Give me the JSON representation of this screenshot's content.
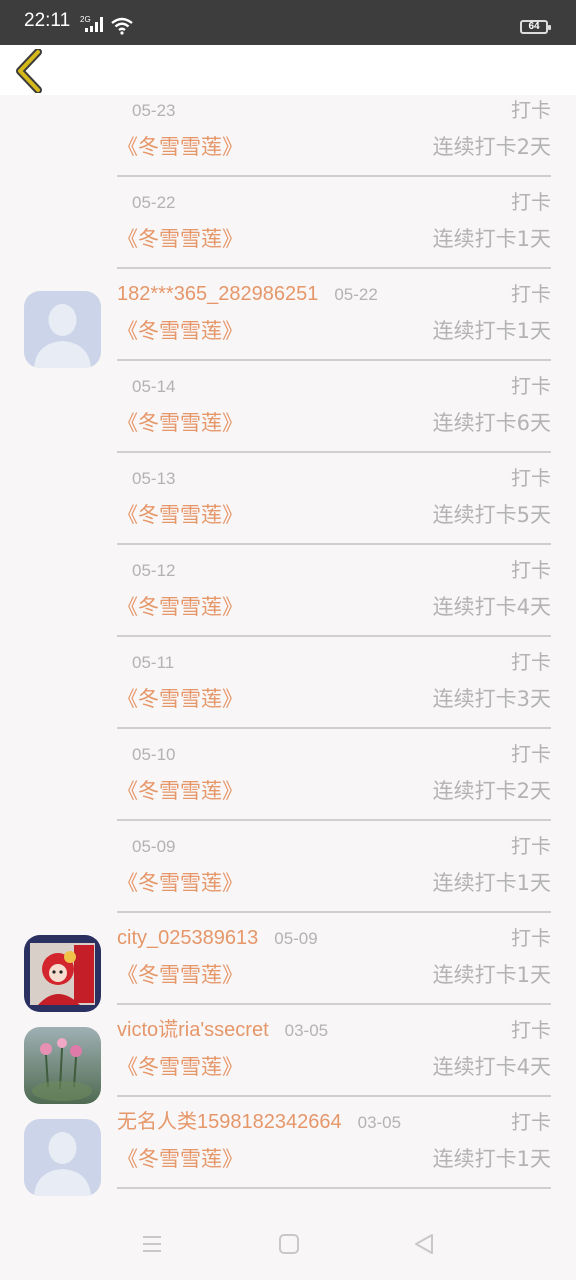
{
  "status_bar": {
    "time": "22:11",
    "network": "2G",
    "battery": "64"
  },
  "entries": [
    {
      "user": "",
      "avatar": "",
      "date": "05-23",
      "action": "打卡",
      "book": "《冬雪雪莲》",
      "streak": "连续打卡2天"
    },
    {
      "user": "",
      "avatar": "",
      "date": "05-22",
      "action": "打卡",
      "book": "《冬雪雪莲》",
      "streak": "连续打卡1天"
    },
    {
      "user": "182***365_282986251",
      "avatar": "default-avatar",
      "date": "05-22",
      "action": "打卡",
      "book": "《冬雪雪莲》",
      "streak": "连续打卡1天"
    },
    {
      "user": "",
      "avatar": "",
      "date": "05-14",
      "action": "打卡",
      "book": "《冬雪雪莲》",
      "streak": "连续打卡6天"
    },
    {
      "user": "",
      "avatar": "",
      "date": "05-13",
      "action": "打卡",
      "book": "《冬雪雪莲》",
      "streak": "连续打卡5天"
    },
    {
      "user": "",
      "avatar": "",
      "date": "05-12",
      "action": "打卡",
      "book": "《冬雪雪莲》",
      "streak": "连续打卡4天"
    },
    {
      "user": "",
      "avatar": "",
      "date": "05-11",
      "action": "打卡",
      "book": "《冬雪雪莲》",
      "streak": "连续打卡3天"
    },
    {
      "user": "",
      "avatar": "",
      "date": "05-10",
      "action": "打卡",
      "book": "《冬雪雪莲》",
      "streak": "连续打卡2天"
    },
    {
      "user": "",
      "avatar": "",
      "date": "05-09",
      "action": "打卡",
      "book": "《冬雪雪莲》",
      "streak": "连续打卡1天"
    },
    {
      "user": "city_025389613",
      "avatar": "cartoon-avatar",
      "date": "05-09",
      "action": "打卡",
      "book": "《冬雪雪莲》",
      "streak": "连续打卡1天"
    },
    {
      "user": "victo谎ria'ssecret",
      "avatar": "flower-avatar",
      "date": "03-05",
      "action": "打卡",
      "book": "《冬雪雪莲》",
      "streak": "连续打卡4天"
    },
    {
      "user": "无名人类1598182342664",
      "avatar": "default-avatar",
      "date": "03-05",
      "action": "打卡",
      "book": "《冬雪雪莲》",
      "streak": "连续打卡1天"
    }
  ],
  "colors": {
    "accent": "#e6976a",
    "muted": "#b3b3b3",
    "background": "#f8f6f7",
    "back_arrow": "#d4b81c"
  }
}
